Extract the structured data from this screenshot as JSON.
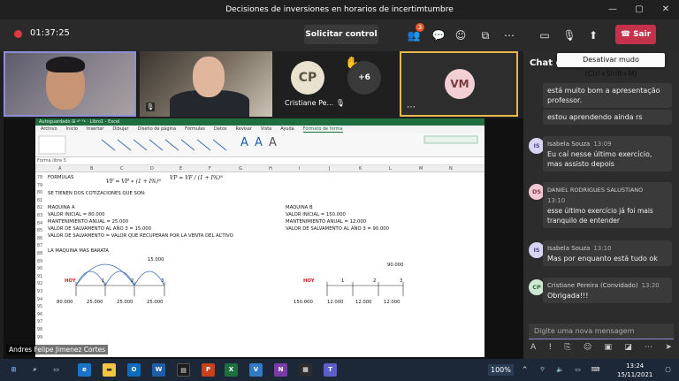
{
  "window": {
    "title": "Decisiones de inversiones en horarios de incertimtumbre",
    "controls": [
      "—",
      "▢",
      "✕"
    ]
  },
  "toolbar": {
    "timer": "01:37:25",
    "request_control": "Solicitar control",
    "participants_badge": "3",
    "leave_label": "Sair",
    "tooltip": "Desativar mudo (Ctrl+Shift+M)"
  },
  "participants": {
    "cp_initials": "CP",
    "cp_name": "Cristiane Pe...",
    "more": "+6",
    "vm_initials": "VM",
    "presenter_name": "Andres Felipe Jimenez Cortes"
  },
  "excel": {
    "title_bar": "Autoguardado  ⊞  ↶  ↷  ·  Libro1 - Excel",
    "menu": [
      "Archivo",
      "Inicio",
      "Insertar",
      "Dibujar",
      "Diseño de página",
      "Fórmulas",
      "Datos",
      "Revisar",
      "Vista",
      "Ayuda",
      "Formato de forma"
    ],
    "formula_bar": "Forma libre 5",
    "columns": [
      "A",
      "B",
      "C",
      "D",
      "E",
      "F",
      "G",
      "H",
      "I",
      "J",
      "K",
      "L",
      "M",
      "N"
    ],
    "rows": [
      "78",
      "79",
      "80",
      "81",
      "82",
      "83",
      "84",
      "85",
      "86",
      "87",
      "88",
      "89",
      "90",
      "91",
      "92",
      "93",
      "94",
      "95",
      "96",
      "97",
      "98",
      "99"
    ],
    "cells": {
      "formulas": "FORMULAS",
      "f1": "VF = VP ∗ (1 + I%)ᴺ",
      "f2": "VP = VF / (1 + I%)ᴺ",
      "intro": "SE TIENEN DOS COTIZACIONES QUE SON:",
      "ma": "MAQUINA A",
      "ma1": "VALOR INICIAL = 80.000",
      "ma2": "MANTENIMIENTO ANUAL = 25.000",
      "ma3": "VALOR DE SALVAMENTO AL AÑO 3 = 15.000",
      "ma4": "VALOR DE SALVAMENTO = VALOR QUE RECUPERAN POR LA VENTA DEL ACTIVO",
      "mb": "MAQUINA B",
      "mb1": "VALOR INICIAL = 150.000",
      "mb2": "MANTENIMIENTO ANUAL = 12.000",
      "mb3": "VALOR DE SALVAMENTO AL AÑO 3 = 90.000",
      "cheap": "LA MAQUINA MAS BARATA",
      "a_salv": "15.000",
      "a_hoy": "HOY",
      "a_1": "1",
      "a_2": "2",
      "a_3": "3",
      "a_80": "80.000",
      "a_25a": "25.000",
      "a_25b": "25.000",
      "a_25c": "25.000",
      "b_salv": "90.000",
      "b_hoy": "HOY",
      "b_1": "1",
      "b_2": "2",
      "b_3": "3",
      "b_150": "150.000",
      "b_12a": "12.000",
      "b_12b": "12.000",
      "b_12c": "12.000"
    }
  },
  "chat": {
    "header": "Chat de",
    "input_placeholder": "Digite uma nova mensagem",
    "messages": [
      {
        "text1": "está muito bom a apresentação",
        "text2": "professor."
      },
      {
        "text1": "estou aprendendo ainda rs"
      },
      {
        "initials": "IS",
        "author": "Isabela Souza",
        "time": "13:09",
        "text1": "Eu caí nesse último exercício,",
        "text2": "mas assisto depois"
      },
      {
        "initials": "DS",
        "author": "DANIEL RODRIGUES SALUSTIANO",
        "time": "13:10",
        "text1": "esse último exercício já foi mais",
        "text2": "tranquilo de entender"
      },
      {
        "initials": "IS",
        "author": "Isabela Souza",
        "time": "13:10",
        "text1": "Mas por enquanto está tudo ok"
      },
      {
        "initials": "CP",
        "author": "Cristiane Pereira (Convidado)",
        "time": "13:20",
        "text1": "Obrigada!!!"
      }
    ]
  },
  "taskbar": {
    "zoom": "100%",
    "time": "13:24",
    "date": "15/11/2021"
  },
  "colors": {
    "accent": "#8f8dd8",
    "leave": "#c4314b",
    "excel_green": "#1e6e3f"
  }
}
